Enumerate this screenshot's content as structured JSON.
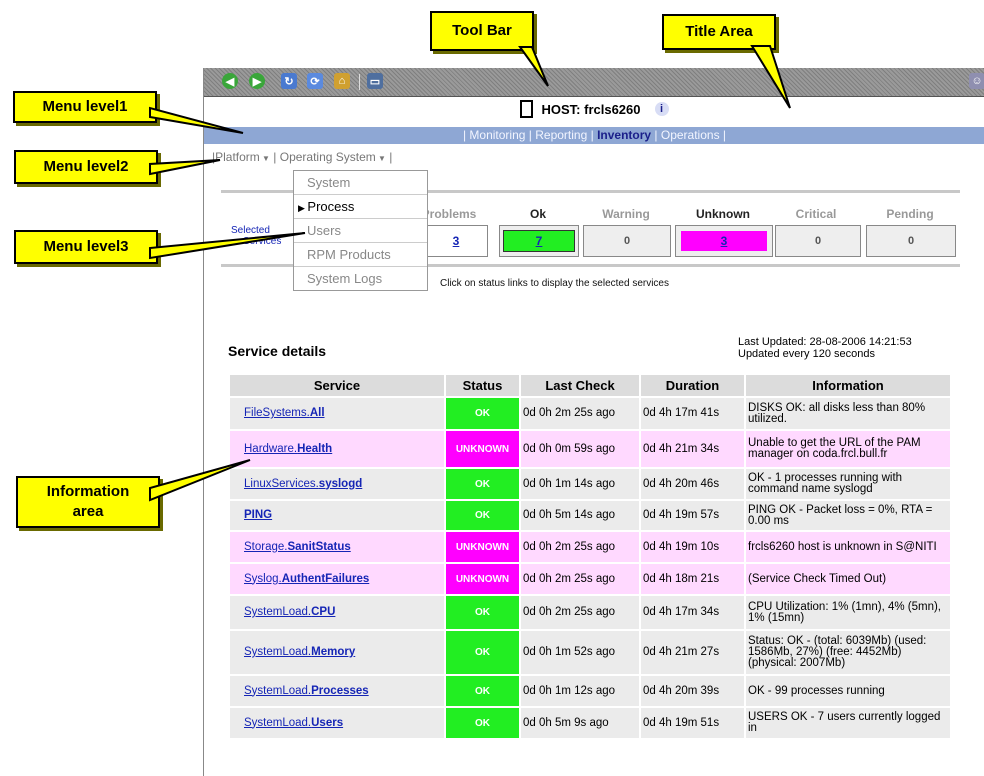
{
  "annotations": {
    "tool_bar": "Tool Bar",
    "title_area": "Title Area",
    "menu_level1": "Menu level1",
    "menu_level2": "Menu level2",
    "menu_level3": "Menu level3",
    "information_line1": "Information",
    "information_line2": "area"
  },
  "toolbar": {
    "icons": [
      "back-icon",
      "forward-icon",
      "refresh-icon",
      "reload-icon",
      "home-icon",
      "window-icon",
      "user-icon"
    ]
  },
  "host": {
    "label": "HOST:",
    "name": "frcls6260",
    "info": "i"
  },
  "menu1": {
    "items": [
      "Monitoring",
      "Reporting",
      "Inventory",
      "Operations"
    ],
    "active": "Inventory"
  },
  "menu2": {
    "items": [
      "Platform",
      "Operating System"
    ]
  },
  "menu3": {
    "items": [
      "System",
      "Process",
      "Users",
      "RPM Products",
      "System Logs"
    ],
    "active": "Process"
  },
  "status_summary": {
    "selected": "Selected",
    "services": "Services",
    "headers": [
      "Problems",
      "Ok",
      "Warning",
      "Unknown",
      "Critical",
      "Pending"
    ],
    "values": [
      "3",
      "7",
      "0",
      "3",
      "0",
      "0"
    ],
    "colors": {
      "ok": "#22ee22",
      "unknown": "#ff00ff"
    }
  },
  "hint": "Click on status links to display the selected services",
  "service_details": {
    "title": "Service details",
    "last_updated": "Last Updated: 28-08-2006 14:21:53",
    "update_freq": "Updated every 120 seconds",
    "headers": [
      "Service",
      "Status",
      "Last Check",
      "Duration",
      "Information"
    ],
    "rows": [
      {
        "group": "FileSystems.",
        "name": "All",
        "status": "OK",
        "last_check": "0d 0h 2m 25s ago",
        "duration": "0d 4h 17m 41s",
        "info": "DISKS OK: all disks less than 80% utilized."
      },
      {
        "group": "Hardware.",
        "name": "Health",
        "status": "UNKNOWN",
        "last_check": "0d 0h 0m 59s ago",
        "duration": "0d 4h 21m 34s",
        "info": "Unable to get the URL of the PAM manager on coda.frcl.bull.fr"
      },
      {
        "group": "LinuxServices.",
        "name": "syslogd",
        "status": "OK",
        "last_check": "0d 0h 1m 14s ago",
        "duration": "0d 4h 20m 46s",
        "info": "OK - 1 processes running with command name syslogd"
      },
      {
        "group": "",
        "name": "PING",
        "status": "OK",
        "last_check": "0d 0h 5m 14s ago",
        "duration": "0d 4h 19m 57s",
        "info": "PING OK - Packet loss = 0%, RTA = 0.00 ms"
      },
      {
        "group": "Storage.",
        "name": "SanitStatus",
        "status": "UNKNOWN",
        "last_check": "0d 0h 2m 25s ago",
        "duration": "0d 4h 19m 10s",
        "info": "frcls6260 host is unknown in S@NITI"
      },
      {
        "group": "Syslog.",
        "name": "AuthentFailures",
        "status": "UNKNOWN",
        "last_check": "0d 0h 2m 25s ago",
        "duration": "0d 4h 18m 21s",
        "info": "(Service Check Timed Out)"
      },
      {
        "group": "SystemLoad.",
        "name": "CPU",
        "status": "OK",
        "last_check": "0d 0h 2m 25s ago",
        "duration": "0d 4h 17m 34s",
        "info": "CPU Utilization: 1% (1mn), 4% (5mn), 1% (15mn)"
      },
      {
        "group": "SystemLoad.",
        "name": "Memory",
        "status": "OK",
        "last_check": "0d 0h 1m 52s ago",
        "duration": "0d 4h 21m 27s",
        "info": "Status: OK - (total: 6039Mb) (used: 1586Mb, 27%) (free: 4452Mb) (physical: 2007Mb)"
      },
      {
        "group": "SystemLoad.",
        "name": "Processes",
        "status": "OK",
        "last_check": "0d 0h 1m 12s ago",
        "duration": "0d 4h 20m 39s",
        "info": "OK - 99 processes running"
      },
      {
        "group": "SystemLoad.",
        "name": "Users",
        "status": "OK",
        "last_check": "0d 0h 5m 9s ago",
        "duration": "0d 4h 19m 51s",
        "info": "USERS OK - 7 users currently logged in"
      }
    ]
  },
  "colors": {
    "ok": "#22ee22",
    "unknown": "#ff00ff",
    "row_ok": "#ebebeb",
    "row_unknown": "#ffd9ff",
    "menu": "#8ea7d4"
  }
}
